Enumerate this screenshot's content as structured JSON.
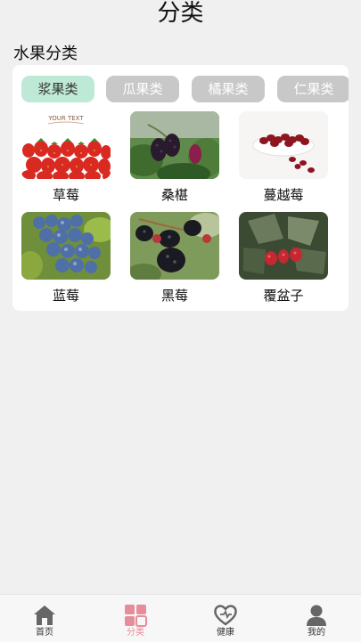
{
  "page": {
    "title": "分类"
  },
  "section": {
    "title": "水果分类"
  },
  "tabs": [
    {
      "label": "浆果类",
      "active": true
    },
    {
      "label": "瓜果类",
      "active": false
    },
    {
      "label": "橘果类",
      "active": false
    },
    {
      "label": "仁果类",
      "active": false
    }
  ],
  "fruits": [
    {
      "label": "草莓",
      "image": "strawberry-photo",
      "watermark": "YOUR TEXT"
    },
    {
      "label": "桑椹",
      "image": "mulberry-photo"
    },
    {
      "label": "蔓越莓",
      "image": "cranberry-photo"
    },
    {
      "label": "蓝莓",
      "image": "blueberry-photo"
    },
    {
      "label": "黑莓",
      "image": "blackberry-photo"
    },
    {
      "label": "覆盆子",
      "image": "raspberry-photo"
    }
  ],
  "nav": [
    {
      "label": "首页",
      "icon": "home-icon",
      "active": false
    },
    {
      "label": "分类",
      "icon": "category-icon",
      "active": true
    },
    {
      "label": "健康",
      "icon": "heart-icon",
      "active": false
    },
    {
      "label": "我的",
      "icon": "user-icon",
      "active": false
    }
  ],
  "colors": {
    "accent": "#e58e99",
    "tab_active_bg": "#bfe9d7",
    "tab_bg": "#c8c8c8"
  }
}
